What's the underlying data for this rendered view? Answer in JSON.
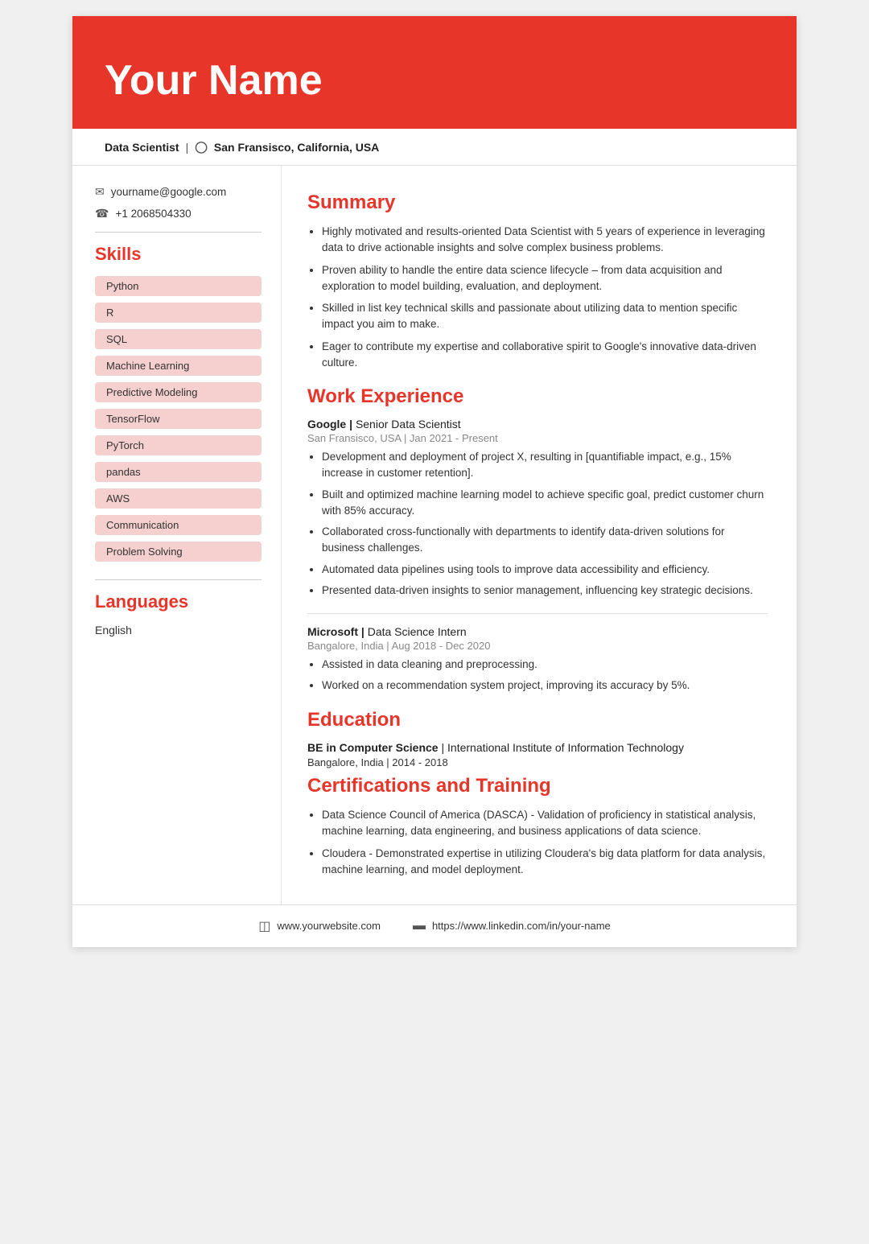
{
  "header": {
    "name": "Your Name",
    "title": "Data Scientist",
    "separator": "|",
    "location_icon": "📍",
    "location": "San Fransisco, California, USA"
  },
  "contact": {
    "email": "yourname@google.com",
    "phone": "+1 2068504330"
  },
  "skills": {
    "section_title": "Skills",
    "items": [
      "Python",
      "R",
      "SQL",
      "Machine Learning",
      "Predictive Modeling",
      "TensorFlow",
      "PyTorch",
      "pandas",
      "AWS",
      "Communication",
      "Problem Solving"
    ]
  },
  "languages": {
    "section_title": "Languages",
    "items": [
      "English"
    ]
  },
  "summary": {
    "section_title": "Summary",
    "points": [
      "Highly motivated and results-oriented Data Scientist with 5 years of experience in leveraging data to drive actionable insights and solve complex business problems.",
      "Proven ability to handle the entire data science lifecycle – from data acquisition and exploration to model building, evaluation, and deployment.",
      "Skilled in list key technical skills and passionate about utilizing data to mention specific impact you aim to make.",
      "Eager to contribute my expertise and collaborative spirit to Google's innovative data-driven culture."
    ]
  },
  "work_experience": {
    "section_title": "Work Experience",
    "jobs": [
      {
        "company": "Google",
        "role": "Senior Data Scientist",
        "location_date": "San Fransisco, USA | Jan 2021 - Present",
        "bullets": [
          "Development and deployment of project X, resulting in [quantifiable impact, e.g., 15% increase in customer retention].",
          "Built and optimized machine learning model to achieve specific goal, predict customer churn with 85% accuracy.",
          "Collaborated cross-functionally with departments to identify data-driven solutions for business challenges.",
          "Automated data pipelines using tools to improve data accessibility and efficiency.",
          "Presented data-driven insights to senior management, influencing key strategic decisions."
        ]
      },
      {
        "company": "Microsoft",
        "role": "Data Science Intern",
        "location_date": "Bangalore, India | Aug 2018 - Dec 2020",
        "bullets": [
          "Assisted in data cleaning and preprocessing.",
          "Worked on a recommendation system project, improving its accuracy by 5%."
        ]
      }
    ]
  },
  "education": {
    "section_title": "Education",
    "degree": "BE in Computer Science",
    "institution": "International Institute of Information Technology",
    "location_date": "Bangalore, India | 2014 - 2018"
  },
  "certifications": {
    "section_title": "Certifications and Training",
    "items": [
      "Data Science Council of America (DASCA) - Validation of proficiency in statistical analysis, machine learning, data engineering, and business applications of data science.",
      "Cloudera - Demonstrated expertise in utilizing Cloudera's big data platform for data analysis, machine learning, and model deployment."
    ]
  },
  "footer": {
    "website": "www.yourwebsite.com",
    "linkedin": "https://www.linkedin.com/in/your-name"
  }
}
